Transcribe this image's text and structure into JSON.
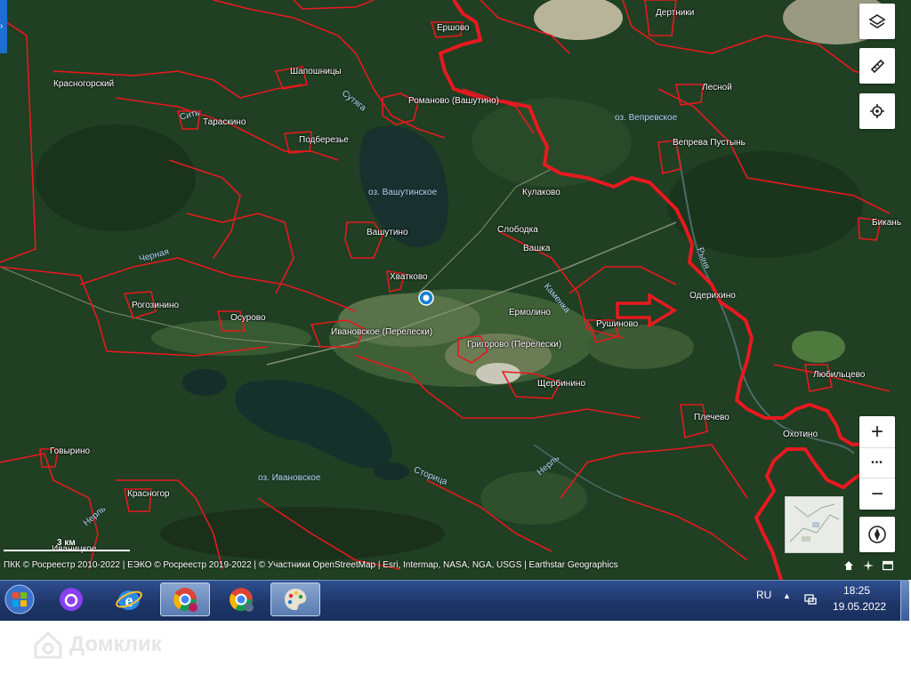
{
  "map": {
    "places": [
      {
        "name": "Ершово"
      },
      {
        "name": "Дертники"
      },
      {
        "name": "Шапошницы"
      },
      {
        "name": "Красногорский"
      },
      {
        "name": "Тараскино"
      },
      {
        "name": "Романово (Вашутино)"
      },
      {
        "name": "Лесной"
      },
      {
        "name": "Подберезье"
      },
      {
        "name": "Вепрева Пустынь"
      },
      {
        "name": "Кулаково"
      },
      {
        "name": "Слободка"
      },
      {
        "name": "Вашутино"
      },
      {
        "name": "Вашка"
      },
      {
        "name": "Бикань"
      },
      {
        "name": "Хватково"
      },
      {
        "name": "Одерихино"
      },
      {
        "name": "Рогозинино"
      },
      {
        "name": "Ермолино"
      },
      {
        "name": "Осурово"
      },
      {
        "name": "Ивановское (Перелески)"
      },
      {
        "name": "Рушиново"
      },
      {
        "name": "Григорово (Перелески)"
      },
      {
        "name": "Любильцево"
      },
      {
        "name": "Щербинино"
      },
      {
        "name": "Плечево"
      },
      {
        "name": "Охотино"
      },
      {
        "name": "Говырино"
      },
      {
        "name": "Красногор"
      },
      {
        "name": "Иваницкое"
      }
    ],
    "water": [
      {
        "name": "оз. Вепревское"
      },
      {
        "name": "оз. Вашутинское"
      },
      {
        "name": "оз. Ивановское"
      }
    ],
    "rivers": [
      {
        "name": "Сутяга"
      },
      {
        "name": "Сить"
      },
      {
        "name": "Черная"
      },
      {
        "name": "Каменка"
      },
      {
        "name": "Рыня"
      },
      {
        "name": "Нерль"
      },
      {
        "name": "Сторица"
      },
      {
        "name": "Нерль"
      }
    ],
    "scale_label": "3 км",
    "attribution": "ПКК © Росреестр 2010-2022 | ЕЭКО © Росреестр 2019-2022 | © Участники OpenStreetMap | Esri, Intermap, NASA, NGA, USGS | Earthstar Geographics",
    "colors": {
      "boundary": "#e8191f",
      "arrow": "#e8191f",
      "marker": "#1a7fd4",
      "forest": "#1c3a1f"
    }
  },
  "controls": {
    "layers": "layers-icon",
    "ruler": "ruler-icon",
    "locate": "locate-icon",
    "zoom_in": "+",
    "zoom_more": "•••",
    "zoom_out": "−",
    "compass": "compass-icon"
  },
  "taskbar": {
    "lang": "RU",
    "time": "18:25",
    "date": "19.05.2022",
    "apps": [
      "start-orb",
      "alice-app",
      "internet-explorer",
      "chrome",
      "chrome",
      "paint"
    ]
  },
  "watermark": "Домклик"
}
